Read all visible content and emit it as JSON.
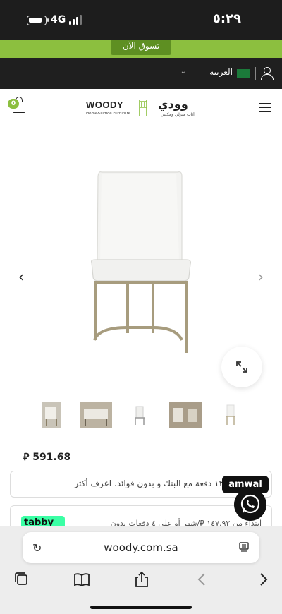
{
  "status_bar": {
    "time": "٥:٢٩",
    "network": "4G"
  },
  "promo": {
    "shop_now": "تسوق الآن"
  },
  "lang_bar": {
    "language": "العربية"
  },
  "header": {
    "cart_count": "0",
    "logo_en": "WOODY",
    "logo_en_sub": "Home&Office Furniture",
    "logo_ar": "وودي",
    "logo_ar_sub": "أثاث منزلي ومكتبي"
  },
  "product": {
    "price": "591.68",
    "currency_symbol": "⃁"
  },
  "installments": {
    "amwal_text": "قسّطها الى ١٢ دفعة مع البنك و بدون فوائد. اعرف أكثر",
    "amwal_badge": "amwal",
    "tabby_text": "ابتداء من ١٤٧.٩٢ ⃁/شهر أو على ٤ دفعات بدون",
    "tabby_badge": "tabby"
  },
  "browser": {
    "url": "woody.com.sa"
  },
  "colors": {
    "brand_green": "#8cbf3f",
    "dark_bar": "#1f1f1f",
    "tabby_green": "#3bffa5"
  },
  "icons": {
    "user": "user-icon",
    "cart": "cart-icon",
    "menu": "hamburger-menu-icon",
    "zoom": "expand-icon",
    "whatsapp": "whatsapp-icon",
    "reload": "reload-icon",
    "reader": "reader-icon",
    "tabs": "tabs-icon",
    "bookmarks": "bookmarks-icon",
    "share": "share-icon",
    "back": "back-icon",
    "forward": "forward-icon"
  }
}
